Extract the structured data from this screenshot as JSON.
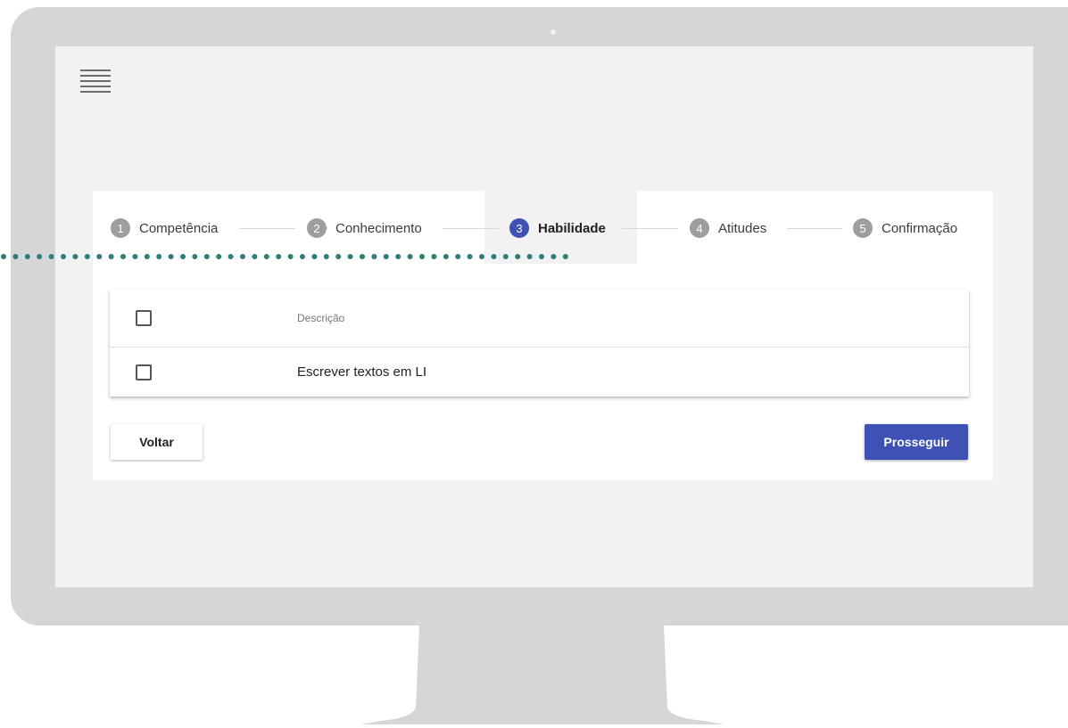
{
  "stepper": {
    "steps": [
      {
        "number": "1",
        "label": "Competência"
      },
      {
        "number": "2",
        "label": "Conhecimento"
      },
      {
        "number": "3",
        "label": "Habilidade"
      },
      {
        "number": "4",
        "label": "Atitudes"
      },
      {
        "number": "5",
        "label": "Confirmação"
      }
    ],
    "active_step": 3
  },
  "table": {
    "header": "Descrição",
    "rows": [
      {
        "description": "Escrever textos em LI"
      }
    ]
  },
  "actions": {
    "back_label": "Voltar",
    "next_label": "Prosseguir"
  },
  "colors": {
    "accent": "#3f51b5",
    "inactive_step": "#9e9e9e",
    "annotation_dots": "#2e7d7b",
    "monitor": "#d6d6d6"
  },
  "icons": {
    "menu": "hamburger-menu-icon"
  }
}
